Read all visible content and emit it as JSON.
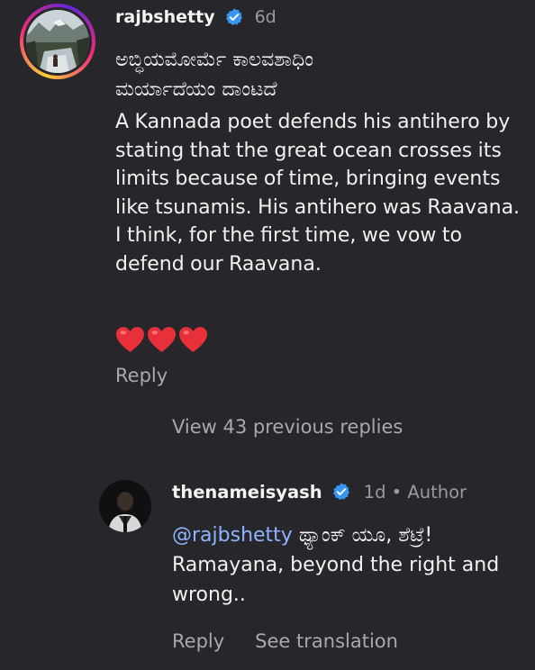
{
  "comment1": {
    "username": "rajbshetty",
    "time": "6d",
    "kannada_line1": "ಅಬ್ಧಿಯಮೋರ್ಮೆ ಕಾಲವಶಾಧಿಂ",
    "kannada_line2": "ಮರ್ಯಾದೆಯಂ ದಾಂಟದೆ",
    "text": "A Kannada poet defends his antihero by stating that the great ocean crosses its limits because of time, bringing events like tsunamis. His antihero was Raavana. I think, for the first time, we vow to defend our Raavana.",
    "hearts": 3,
    "heart_color": "#e8303a",
    "reply_label": "Reply"
  },
  "view_replies_label": "View 43 previous replies",
  "comment2": {
    "username": "thenameisyash",
    "time": "1d",
    "separator": "•",
    "role": "Author",
    "mention": "@rajbshetty",
    "kannada_text": "ಥ್ಯಾಂಕ್ ಯೂ, ಶೆಟ್ರೆ!",
    "text": "Ramayana, beyond the right and wrong..",
    "reply_label": "Reply",
    "translate_label": "See translation"
  },
  "colors": {
    "background": "#26262b",
    "verified_badge": "#3797f0",
    "mention": "#8fb4ff",
    "muted_text": "#a8a8ad"
  }
}
